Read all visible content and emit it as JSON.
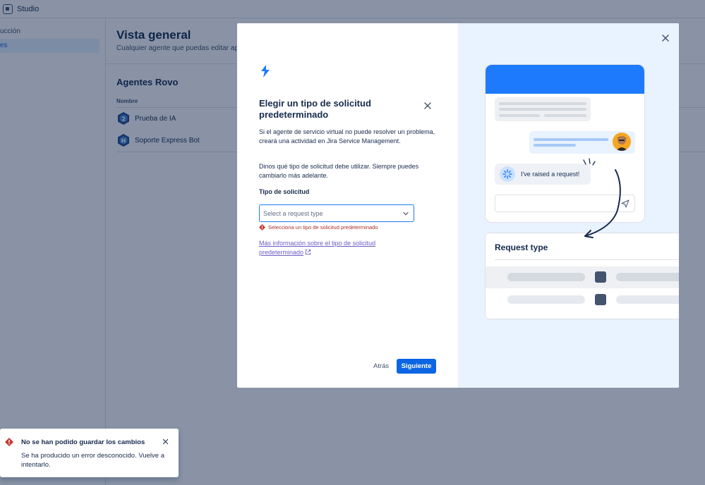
{
  "app": {
    "title": "Studio"
  },
  "sidebar": {
    "items": [
      {
        "label": "ucción"
      },
      {
        "label": "es"
      }
    ]
  },
  "main": {
    "title": "Vista general",
    "subtitle": "Cualquier agente que puedas editar apa",
    "agents_title": "Agentes Rovo",
    "column_name": "Nombre",
    "rows": [
      {
        "label": "Prueba de IA"
      },
      {
        "label": "Soporte Express Bot"
      }
    ]
  },
  "dialog": {
    "title": "Elegir un tipo de solicitud predeterminado",
    "paragraph1": "Si el agente de servicio virtual no puede resolver un problema, creará una actividad en Jira Service Management.",
    "paragraph2": "Dinos qué tipo de solicitud debe utilizar. Siempre puedes cambiarlo más adelante.",
    "field_label": "Tipo de solicitud",
    "select_placeholder": "Select a request type",
    "error_text": "Selecciona un tipo de solicitud predeterminado",
    "help_link": "Más información sobre el tipo de solicitud predeterminado",
    "back_label": "Atrás",
    "next_label": "Siguiente"
  },
  "illustration": {
    "raised_text": "I've raised a request!",
    "request_type_title": "Request type"
  },
  "toast": {
    "title": "No se han podido guardar los cambios",
    "body": "Se ha producido un error desconocido. Vuelve a intentarlo."
  },
  "colors": {
    "primary": "#0c66e4",
    "brand_blue": "#1d7afc",
    "error": "#c9372c",
    "link": "#6e5dc6",
    "illustration_bg": "#e9f2ff"
  },
  "icons": [
    "app-logo-icon",
    "agent-hex-icon",
    "close-icon",
    "lightning-icon",
    "chevron-down-icon",
    "error-icon",
    "external-link-icon",
    "send-icon",
    "message-icon",
    "sparkle-icon"
  ]
}
